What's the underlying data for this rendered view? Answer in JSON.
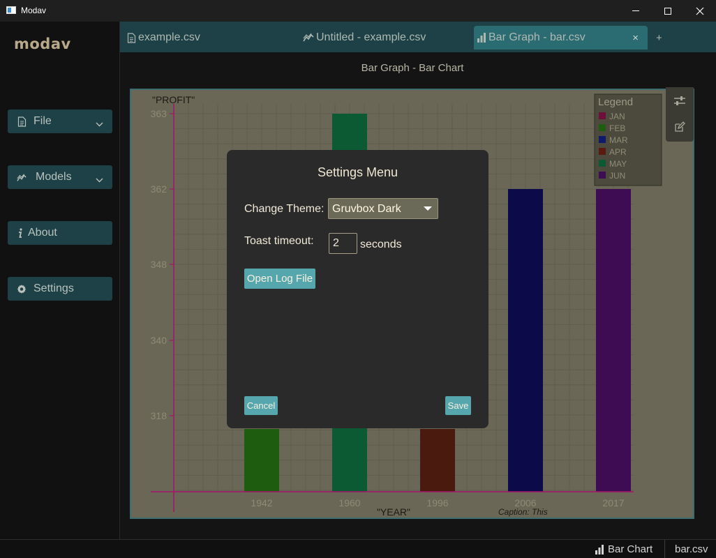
{
  "window": {
    "title": "Modav"
  },
  "sidebar": {
    "logo": "modav",
    "items": [
      {
        "label": "File",
        "icon": "file-icon",
        "has_dropdown": true
      },
      {
        "label": "Models",
        "icon": "chart-line-icon",
        "has_dropdown": true
      },
      {
        "label": "About",
        "icon": "info-icon",
        "has_dropdown": false
      },
      {
        "label": "Settings",
        "icon": "gear-icon",
        "has_dropdown": false
      }
    ]
  },
  "tabs": [
    {
      "label": "example.csv",
      "icon": "file-icon",
      "active": false
    },
    {
      "label": "Untitled - example.csv",
      "icon": "chart-line-icon",
      "active": false
    },
    {
      "label": "Bar Graph - bar.csv",
      "icon": "bar-chart-icon",
      "active": true,
      "close": "×"
    }
  ],
  "tab_add": "+",
  "content": {
    "title": "Bar Graph - Bar Chart"
  },
  "chart_data": {
    "type": "bar",
    "categories": [
      "1942",
      "1960",
      "1996",
      "2006",
      "2017"
    ],
    "values": [
      318,
      363,
      318,
      362,
      362
    ],
    "colors": [
      "#1e5c10",
      "#0b5a34",
      "#4a1a0e",
      "#0c0a48",
      "#3e0c52"
    ],
    "ylabel": "\"PROFIT\"",
    "xlabel": "\"YEAR\"",
    "caption": "Caption: This",
    "y_ticks": [
      "363",
      "362",
      "348",
      "340",
      "318"
    ],
    "legend": {
      "title": "Legend",
      "placement": "top-right",
      "entries": [
        {
          "label": "JAN",
          "color": "#6e0f3a"
        },
        {
          "label": "FEB",
          "color": "#1e5c10"
        },
        {
          "label": "MAR",
          "color": "#101a6a"
        },
        {
          "label": "APR",
          "color": "#5a1a10"
        },
        {
          "label": "MAY",
          "color": "#0b5a34"
        },
        {
          "label": "JUN",
          "color": "#3e0c52"
        }
      ]
    },
    "grid": true,
    "axis_color": "#a5146b"
  },
  "dialog": {
    "title": "Settings Menu",
    "theme_label": "Change Theme:",
    "theme_value": "Gruvbox Dark",
    "timeout_label": "Toast timeout:",
    "timeout_value": "2",
    "timeout_unit": "seconds",
    "open_log": "Open Log File",
    "cancel": "Cancel",
    "save": "Save"
  },
  "statusbar": {
    "chart_type": "Bar Chart",
    "file": "bar.csv"
  }
}
